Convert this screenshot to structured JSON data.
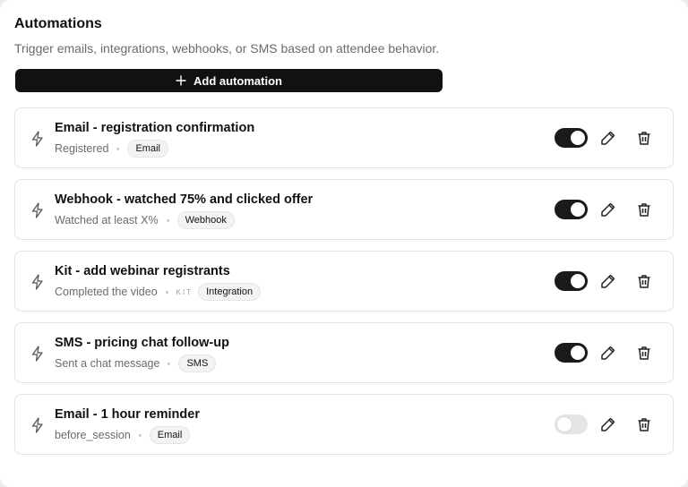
{
  "header": {
    "title": "Automations",
    "subtitle": "Trigger emails, integrations, webhooks, or SMS based on attendee behavior."
  },
  "add_button": {
    "label": "Add automation",
    "icon": "plus-icon"
  },
  "automations": [
    {
      "title": "Email - registration confirmation",
      "trigger": "Registered",
      "brand": "",
      "badge": "Email",
      "enabled": true
    },
    {
      "title": "Webhook - watched 75% and clicked offer",
      "trigger": "Watched at least X%",
      "brand": "",
      "badge": "Webhook",
      "enabled": true
    },
    {
      "title": "Kit - add webinar registrants",
      "trigger": "Completed the video",
      "brand": "KIT",
      "badge": "Integration",
      "enabled": true
    },
    {
      "title": "SMS - pricing chat follow-up",
      "trigger": "Sent a chat message",
      "brand": "",
      "badge": "SMS",
      "enabled": true
    },
    {
      "title": "Email - 1 hour reminder",
      "trigger": "before_session",
      "brand": "",
      "badge": "Email",
      "enabled": false
    }
  ],
  "icons": {
    "row_icon": "lightning-bolt-icon",
    "edit": "pencil-icon",
    "delete": "trash-icon"
  },
  "colors": {
    "toggle_on": "#1a1a1a",
    "toggle_off": "#e5e5e5",
    "primary_button": "#111111"
  }
}
